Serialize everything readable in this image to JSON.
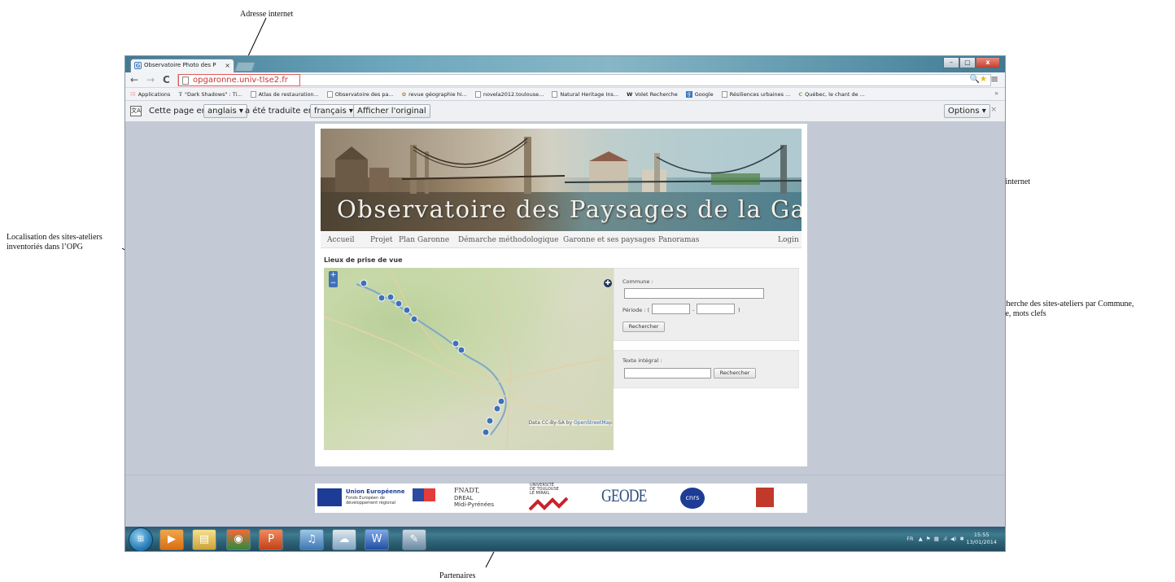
{
  "annotations": {
    "address": "Adresse internet",
    "rubriques": "Rubriques du site internet",
    "localisation": [
      "Localisation des sites-ateliers",
      "inventoriés dans l’OPG"
    ],
    "recherche": [
      "Recherche des sites-ateliers par Commune,",
      "Date, mots clefs"
    ],
    "partenaires": "Partenaires"
  },
  "browser": {
    "tab_title": "Observatoire Photo des P",
    "tab_close": "×",
    "url": "opgaronne.univ-tlse2.fr",
    "nav": {
      "back": "←",
      "forward": "→",
      "reload": "C"
    },
    "bookmarks": [
      "Applications",
      "\"Dark Shadows\" : Ti...",
      "Atlas de restauration...",
      "Observatoire des pa...",
      "revue géographie hi...",
      "novela2012.toulouse...",
      "Natural Heritage Ins...",
      "Volet Recherche",
      "Google",
      "Résiliences urbaines ...",
      "Québec, le chant de ..."
    ],
    "bookmarks_more": "»"
  },
  "translate_bar": {
    "text1": "Cette page en",
    "source_lang": "anglais ▾",
    "text2": "a été traduite en",
    "target_lang": "français ▾",
    "show_original": "Afficher l'original",
    "options": "Options ▾",
    "close": "×"
  },
  "site": {
    "title": "Observatoire des Paysages de la Garonne",
    "nav": [
      "Accueil",
      "Projet",
      "Plan Garonne",
      "Démarche méthodologique",
      "Garonne et ses paysages",
      "Panoramas"
    ],
    "login": "Login",
    "map_heading": "Lieux de prise de vue",
    "map_attribution_prefix": "Data CC-By-SA by",
    "map_attribution_link": "OpenStreetMap",
    "zoom_in": "+",
    "zoom_out": "−",
    "search": {
      "commune_label": "Commune :",
      "periode_label": "Période : (",
      "periode_sep": "-",
      "periode_end": ")",
      "search_button": "Rechercher",
      "fulltext_label": "Texte intégral :",
      "fulltext_button": "Rechercher"
    }
  },
  "partners": {
    "eu_title": "Union Européenne",
    "eu_sub1": "Fonds Européen de",
    "eu_sub2": "développement régional",
    "fnadt1": "FNADT,",
    "fnadt2": "DREAL",
    "fnadt3": "Midi-Pyrénées",
    "utm1": "UNIVERSITÉ",
    "utm2": "DE TOULOUSE",
    "utm3": "LE MIRAIL",
    "geode": "GEODE",
    "cnrs": "cnrs"
  },
  "taskbar": {
    "lang": "FR",
    "time": "15:55",
    "date": "13/01/2014"
  }
}
